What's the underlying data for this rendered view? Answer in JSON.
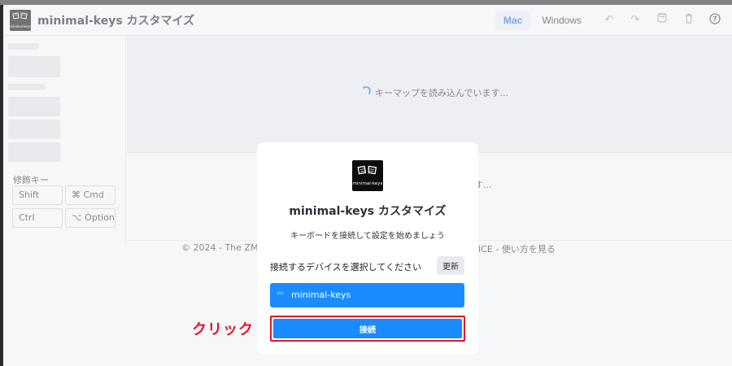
{
  "header": {
    "app_name": "minimal-keys カスタマイズ",
    "logo_text": "minimal-keys",
    "os_options": [
      "Mac",
      "Windows"
    ],
    "active_os": "Mac",
    "tools": [
      "undo-icon",
      "redo-icon",
      "save-icon",
      "trash-icon",
      "help-icon"
    ]
  },
  "sidebar": {
    "modifier_title": "修飾キー",
    "modifier_keys": [
      "Shift",
      "⌘ Cmd",
      "Ctrl",
      "⌥ Option"
    ]
  },
  "main": {
    "loading_text": "キーマップを読み込んでいます...",
    "loading_text_partial": "ます..."
  },
  "footer": {
    "left": "© 2024 - The ZM",
    "right": "ICE - 使い方を見る"
  },
  "modal": {
    "logo_text": "minimal-keys",
    "title": "minimal-keys カスタマイズ",
    "subtitle": "キーボードを接続して設定を始めましょう",
    "select_label": "接続するデバイスを選択してください",
    "refresh_label": "更新",
    "device": {
      "tag": "BLE",
      "name": "minimal-keys"
    },
    "connect_label": "接続"
  },
  "annotation": {
    "click_label": "クリック",
    "color": "#e6122a"
  },
  "colors": {
    "accent": "#1a8cff",
    "highlight": "#e6122a"
  }
}
